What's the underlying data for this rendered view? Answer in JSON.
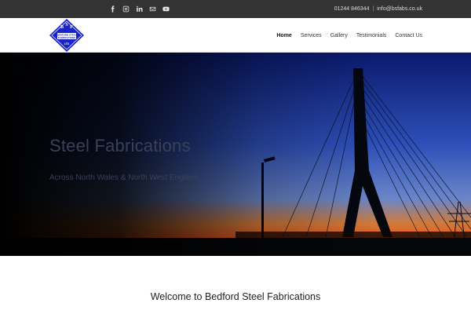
{
  "topbar": {
    "social_icons": [
      "facebook-icon",
      "instagram-icon",
      "linkedin-icon",
      "mail-icon",
      "youtube-icon"
    ],
    "phone": "01244 846344",
    "separator": "|",
    "email": "info@bsfabs.co.uk"
  },
  "logo": {
    "letters": [
      "B",
      "S",
      "F"
    ],
    "line1": "BEDFORD STEEL",
    "line2": "FABRICATIONS",
    "line3": "LTD"
  },
  "nav": {
    "items": [
      "Home",
      "Services",
      "Gallery",
      "Testimonials",
      "Contact Us"
    ],
    "active": "Home"
  },
  "hero": {
    "title": "Steel Fabrications",
    "subtitle": "Across North Wales & North West England"
  },
  "welcome": {
    "heading": "Welcome to Bedford Steel Fabrications"
  },
  "colors": {
    "topbar_bg": "#333333",
    "logo_blue": "#1a23c8",
    "hero_text": "#3a4057"
  }
}
